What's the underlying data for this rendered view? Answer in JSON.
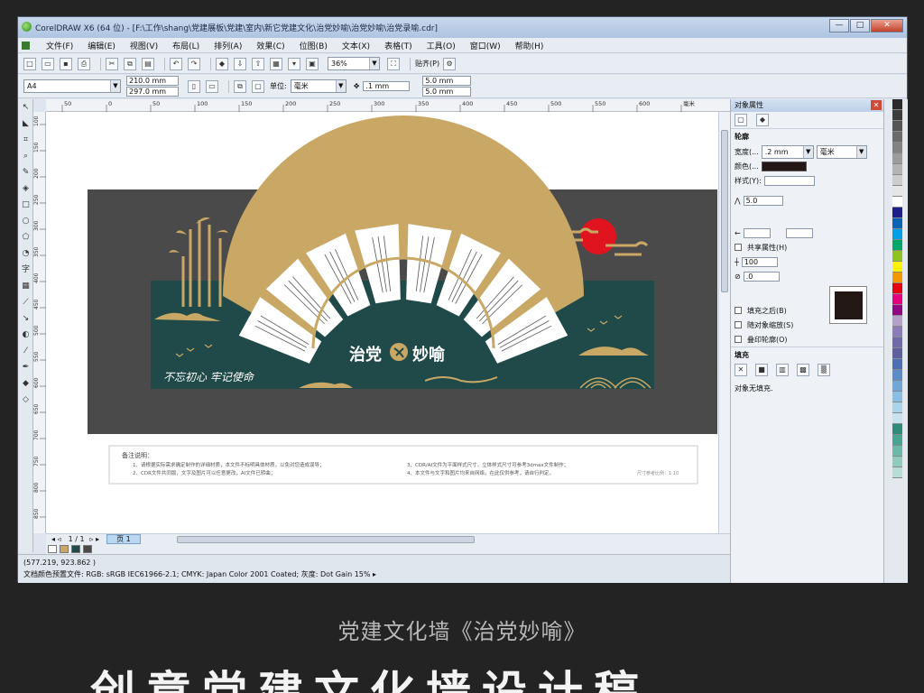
{
  "window": {
    "title": "CorelDRAW X6 (64 位) - [F:\\工作\\shang\\党建展板\\党建\\室内\\新它党建文化\\治党妙喻\\治党妙喻\\治党录喻.cdr]",
    "controls": [
      "—",
      "□",
      "✕"
    ]
  },
  "menu": [
    "文件(F)",
    "编辑(E)",
    "视图(V)",
    "布局(L)",
    "排列(A)",
    "效果(C)",
    "位图(B)",
    "文本(X)",
    "表格(T)",
    "工具(O)",
    "窗口(W)",
    "帮助(H)"
  ],
  "toolbar": {
    "zoom": "36%",
    "snap": "贴齐(P)"
  },
  "property_bar": {
    "page_size": "A4",
    "width": "210.0 mm",
    "height": "297.0 mm",
    "unit_label": "单位:",
    "unit": "毫米",
    "nudge": ".1 mm",
    "dup_x": "5.0 mm",
    "dup_y": "5.0 mm"
  },
  "rulers": {
    "h_ticks": [
      "50",
      "0",
      "50",
      "100",
      "150",
      "200",
      "250",
      "300",
      "350",
      "400",
      "450",
      "500",
      "550",
      "600",
      "毫米"
    ],
    "v_ticks": [
      "100",
      "150",
      "200",
      "250",
      "300",
      "350",
      "400",
      "450",
      "500",
      "550",
      "600",
      "650",
      "700",
      "750",
      "800",
      "850"
    ]
  },
  "design": {
    "fan_title": "治党妙喻",
    "slogan": "不忘初心  牢记使命",
    "colors": {
      "panel": "#4a4a4a",
      "teal": "#1f4a49",
      "gold": "#c9a765",
      "red": "#e0141e"
    }
  },
  "notes": {
    "heading": "备注说明：",
    "line1": "1、请根据实际需求确定制作的详细材质，本文件不标明具体材质，以免对您造成误导；",
    "line2": "2、CDR文件共同版，文字及图片可以任意更改，AI文件已转曲；",
    "line3": "3、CDR/AI文件为平面样式尺寸，立体样式尺寸可参考3dmax文件制作；",
    "line4": "4、本文件与文字和图片均来自网络，在此仅供参考，请自行判定。",
    "scale": "尺寸参考比例：1:10"
  },
  "pagebar": {
    "page_count": "1 / 1",
    "page_tab": "页 1"
  },
  "status": {
    "coords": "(577.219, 923.862 )",
    "profile": "文档颜色预置文件: RGB: sRGB IEC61966-2.1; CMYK: Japan Color 2001 Coated; 灰度: Dot Gain 15% ▸"
  },
  "docker": {
    "title": "对象属性",
    "outline_head": "轮廓",
    "width_label": "宽度(...",
    "width_value": ".2 mm",
    "width_unit": "毫米",
    "color_label": "颜色(...",
    "style_label": "样式(Y):",
    "miter_value": "5.0",
    "shared_label": "共享属性(H)",
    "angle_value": "100",
    "nib_value": ".0",
    "fill_behind": "填充之后(B)",
    "scale_with": "随对象缩放(S)",
    "overprint": "叠印轮廓(O)",
    "fill_head": "填充",
    "fill_status": "对象无填充."
  },
  "caption": "党建文化墙《治党妙喻》",
  "big_title": "创意党建文化墙设计稿"
}
